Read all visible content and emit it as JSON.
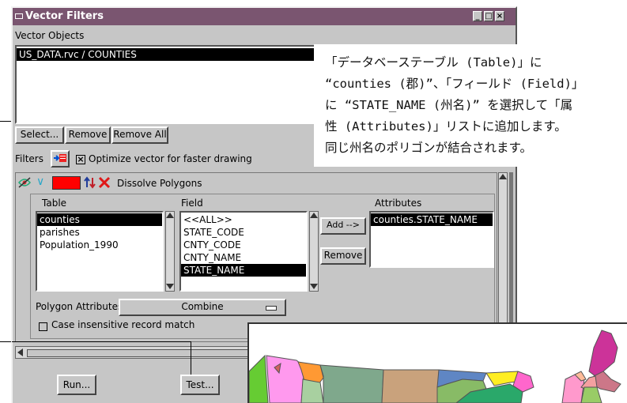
{
  "window": {
    "title": "Vector Filters"
  },
  "vector_objects": {
    "label": "Vector Objects",
    "items": [
      "US_DATA.rvc / COUNTIES"
    ],
    "buttons": {
      "select": "Select...",
      "remove": "Remove",
      "remove_all": "Remove All"
    }
  },
  "filters": {
    "label": "Filters",
    "optimize_label": "Optimize vector for faster drawing",
    "optimize_checked": true
  },
  "dissolve": {
    "label": "Dissolve Polygons",
    "swatch_color": "#ff0000",
    "table": {
      "header": "Table",
      "items": [
        "counties",
        "parishes",
        "Population_1990"
      ],
      "selected": "counties"
    },
    "field": {
      "header": "Field",
      "items": [
        "<<ALL>>",
        "STATE_CODE",
        "CNTY_CODE",
        "CNTY_NAME",
        "STATE_NAME"
      ],
      "selected": "STATE_NAME"
    },
    "attributes": {
      "header": "Attributes",
      "items": [
        "counties.STATE_NAME"
      ]
    },
    "add_button": "Add -->",
    "remove_button": "Remove",
    "polygon_attributes_label": "Polygon Attributes:",
    "polygon_attributes_value": "Combine",
    "case_insensitive_label": "Case insensitive record match"
  },
  "bottom_buttons": {
    "run": "Run...",
    "test": "Test..."
  },
  "caption": {
    "lines": [
      "「データベーステーブル (Table)」に",
      "“counties (郡)”、「フィールド (Field)」",
      "に “STATE_NAME (州名)” を選択して「属",
      "性 (Attributes)」リストに追加します。",
      "同じ州名のポリゴンが結合されます。"
    ]
  },
  "colors": {
    "titlebar": "#7a5570",
    "window": "#c6c6c6",
    "selection": "#000000"
  }
}
